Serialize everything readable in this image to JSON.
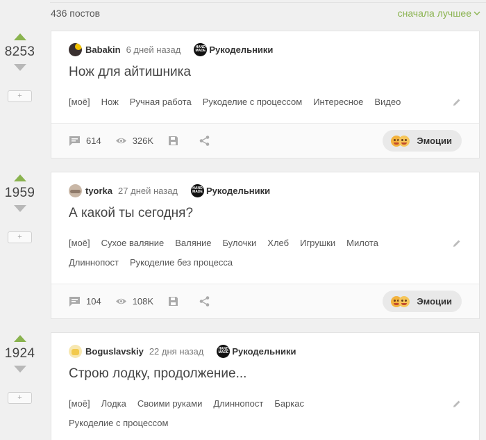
{
  "header": {
    "posts_count": "436 постов",
    "sort_label": "сначала лучшее"
  },
  "posts": [
    {
      "rating": "8253",
      "author": "Babakin",
      "time": "6 дней назад",
      "community": "Рукодельники",
      "community_badge": "HAND MADE",
      "title": "Нож для айтишника",
      "tags": [
        "[моё]",
        "Нож",
        "Ручная работа",
        "Рукоделие с процессом",
        "Интересное",
        "Видео"
      ],
      "comments": "614",
      "views": "326K",
      "emotions_label": "Эмоции",
      "save_label": "+"
    },
    {
      "rating": "1959",
      "author": "tyorka",
      "time": "27 дней назад",
      "community": "Рукодельники",
      "community_badge": "HAND MADE",
      "title": "А какой ты сегодня?",
      "tags": [
        "[моё]",
        "Сухое валяние",
        "Валяние",
        "Булочки",
        "Хлеб",
        "Игрушки",
        "Милота",
        "Длиннопост",
        "Рукоделие без процесса"
      ],
      "comments": "104",
      "views": "108K",
      "emotions_label": "Эмоции",
      "save_label": "+"
    },
    {
      "rating": "1924",
      "author": "Boguslavskiy",
      "time": "22 дня назад",
      "community": "Рукодельники",
      "community_badge": "HAND MADE",
      "title": "Строю лодку, продолжение...",
      "tags": [
        "[моё]",
        "Лодка",
        "Своими руками",
        "Длиннопост",
        "Баркас",
        "Рукоделие с процессом"
      ],
      "save_label": "+"
    }
  ],
  "colors": {
    "accent": "#8ab34f",
    "vote_down": "#b8b8b8"
  },
  "icons": [
    "chevron-down-icon",
    "comment-icon",
    "eye-icon",
    "save-icon",
    "share-icon",
    "pencil-icon",
    "emotions-icon"
  ]
}
